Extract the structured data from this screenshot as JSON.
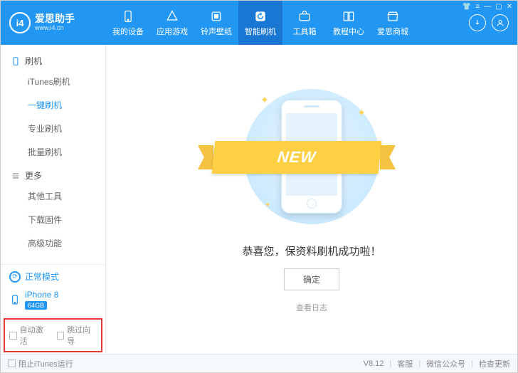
{
  "brand": {
    "name": "爱思助手",
    "site": "www.i4.cn",
    "logo_badge": "i4"
  },
  "nav": {
    "items": [
      {
        "label": "我的设备"
      },
      {
        "label": "应用游戏"
      },
      {
        "label": "铃声壁纸"
      },
      {
        "label": "智能刷机"
      },
      {
        "label": "工具箱"
      },
      {
        "label": "教程中心"
      },
      {
        "label": "爱思商城"
      }
    ],
    "active_index": 3
  },
  "header_icons": {
    "download": "↓",
    "user": "◯"
  },
  "sysbtns": {
    "skin": "👕",
    "menu": "≡",
    "min": "—",
    "max": "▢",
    "close": "✕"
  },
  "sidebar": {
    "section1": {
      "title": "刷机",
      "items": [
        "iTunes刷机",
        "一键刷机",
        "专业刷机",
        "批量刷机"
      ],
      "active_index": 1
    },
    "section2": {
      "title": "更多",
      "items": [
        "其他工具",
        "下载固件",
        "高级功能"
      ]
    },
    "mode": {
      "label": "正常模式"
    },
    "device": {
      "name": "iPhone 8",
      "storage": "64GB"
    },
    "checks": {
      "auto_activate": "自动激活",
      "skip_guide": "跳过向导"
    }
  },
  "main": {
    "ribbon_text": "NEW",
    "success_msg": "恭喜您，保资料刷机成功啦！",
    "ok_label": "确定",
    "log_link": "查看日志"
  },
  "footer": {
    "block_itunes": "阻止iTunes运行",
    "version": "V8.12",
    "support": "客服",
    "wechat": "微信公众号",
    "update": "检查更新"
  }
}
